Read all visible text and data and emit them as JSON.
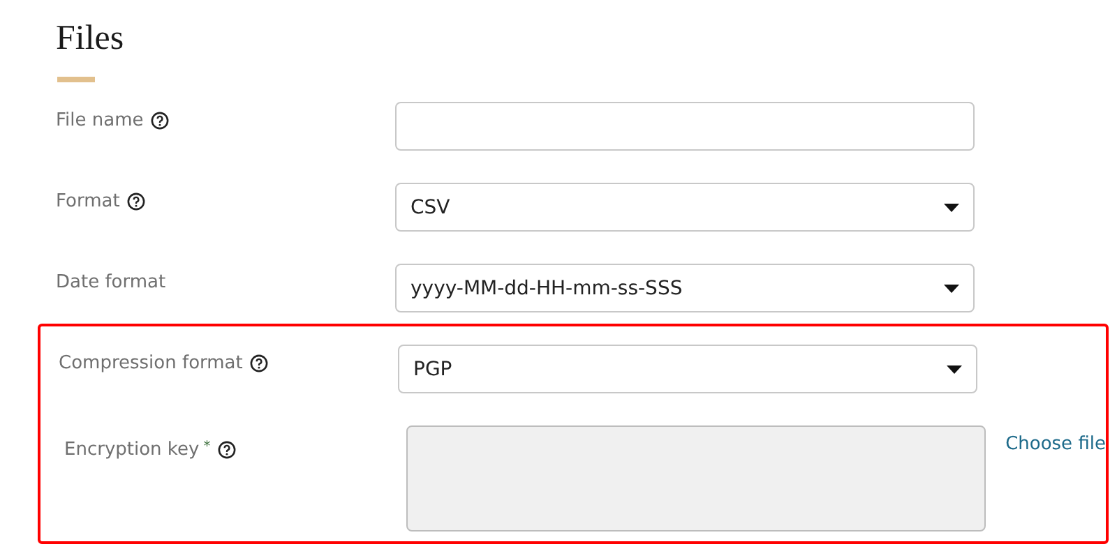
{
  "title": "Files",
  "fields": [
    {
      "label": "File name",
      "kind": "text",
      "help": true
    },
    {
      "label": "Format",
      "kind": "select",
      "help": true,
      "value": "CSV"
    },
    {
      "label": "Date format",
      "kind": "select",
      "help": false,
      "value": "yyyy-MM-dd-HH-mm-ss-SSS"
    }
  ],
  "highlighted_fields": [
    {
      "label": "Compression format",
      "kind": "select",
      "help": true,
      "value": "PGP"
    },
    {
      "label": "Encryption key",
      "kind": "textarea",
      "help": true,
      "required_mark": "*",
      "disabled": true,
      "action": "Choose file"
    }
  ]
}
